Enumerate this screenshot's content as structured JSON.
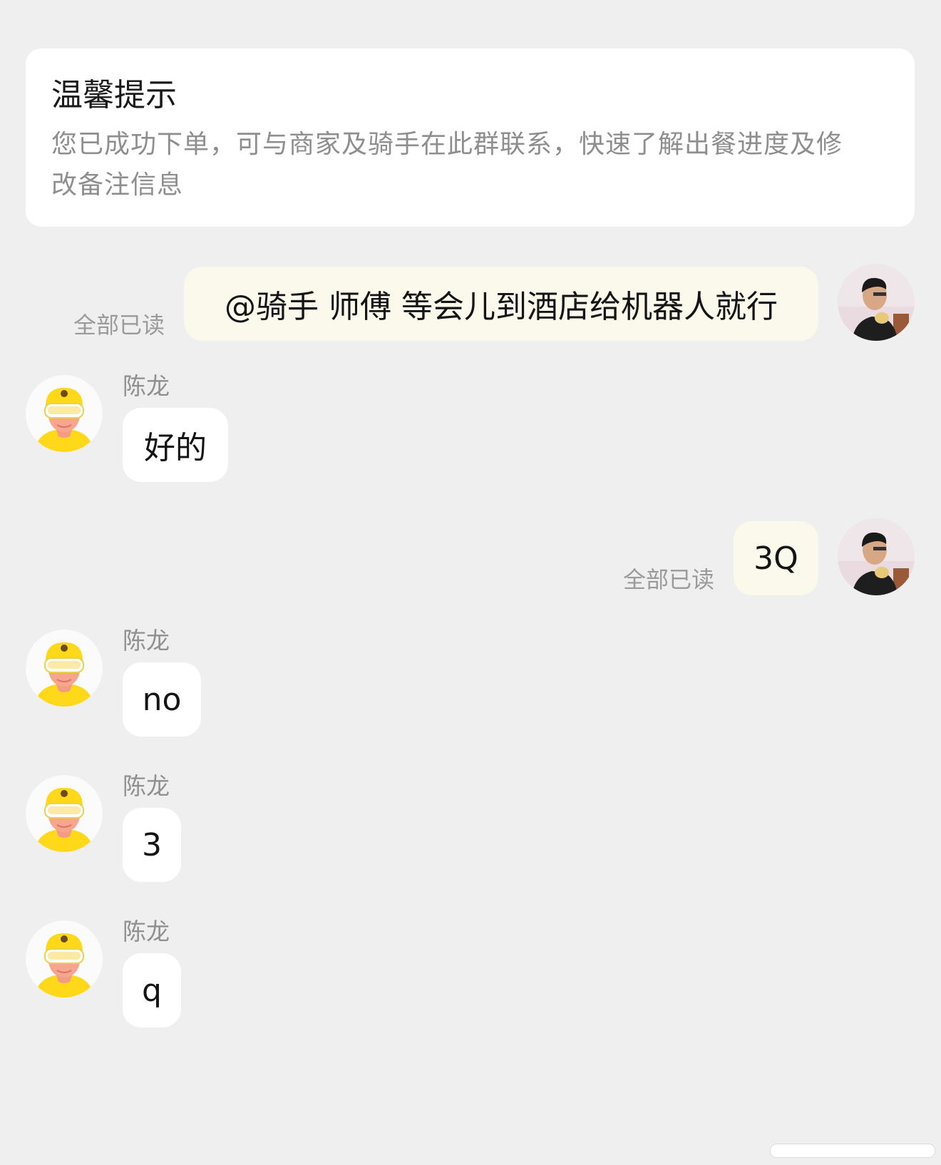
{
  "tip": {
    "title": "温馨提示",
    "line1": "您已成功下单，可与商家及骑手在此群联系，快速了解出餐进度及修",
    "line2": "改备注信息"
  },
  "messages": [
    {
      "side": "out",
      "text": "@骑手 师傅 等会儿到酒店给机器人就行",
      "status": "全部已读",
      "avatar": "user-photo-avatar"
    },
    {
      "side": "in",
      "sender": "陈龙",
      "text": "好的",
      "avatar": "rider-avatar"
    },
    {
      "side": "out",
      "text": "3Q",
      "status": "全部已读",
      "avatar": "user-photo-avatar"
    },
    {
      "side": "in",
      "sender": "陈龙",
      "text": "no",
      "avatar": "rider-avatar"
    },
    {
      "side": "in",
      "sender": "陈龙",
      "text": "3",
      "avatar": "rider-avatar"
    },
    {
      "side": "in",
      "sender": "陈龙",
      "text": "q",
      "avatar": "rider-avatar"
    }
  ],
  "colors": {
    "background": "#efefef",
    "incoming_bubble": "#ffffff",
    "outgoing_bubble": "#fbf9ec",
    "rider_yellow": "#ffd81a"
  }
}
